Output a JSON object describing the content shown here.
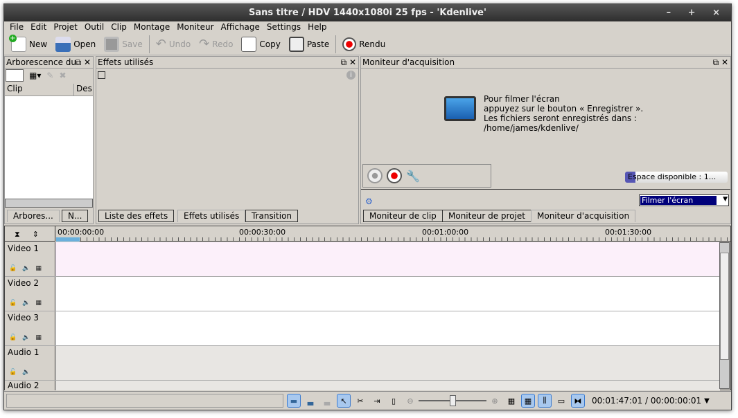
{
  "window": {
    "title": "Sans titre / HDV 1440x1080i 25 fps - 'Kdenlive'",
    "controls": "– + ×"
  },
  "menu": [
    "File",
    "Edit",
    "Projet",
    "Outil",
    "Clip",
    "Montage",
    "Moniteur",
    "Affichage",
    "Settings",
    "Help"
  ],
  "toolbar": {
    "new": "New",
    "open": "Open",
    "save": "Save",
    "undo": "Undo",
    "redo": "Redo",
    "copy": "Copy",
    "paste": "Paste",
    "render": "Rendu"
  },
  "project_tree": {
    "title": "Arborescence du",
    "col_clip": "Clip",
    "col_desc": "Des",
    "tab1": "Arbores...",
    "tab2": "N..."
  },
  "effects": {
    "title": "Effets utilisés",
    "tabs": [
      "Liste des effets",
      "Effets utilisés",
      "Transition"
    ]
  },
  "capture": {
    "title": "Moniteur d'acquisition",
    "msg1": "Pour filmer l'écran",
    "msg2": "appuyez sur le bouton « Enregistrer ».",
    "msg3": "Les fichiers seront enregistrés dans :",
    "msg4": "/home/james/kdenlive/",
    "space": "Espace disponible : 1...",
    "space_fraction": 0.1,
    "mode": "Filmer l'écran",
    "tabs": [
      "Moniteur de clip",
      "Moniteur de projet",
      "Moniteur d'acquisition"
    ]
  },
  "timeline": {
    "ruler": [
      "00:00:00:00",
      "00:00:30:00",
      "00:01:00:00",
      "00:01:30:00"
    ],
    "tracks": [
      "Video 1",
      "Video 2",
      "Video 3",
      "Audio 1",
      "Audio 2"
    ]
  },
  "status": {
    "timecode": "00:01:47:01 / 00:00:00:01",
    "zoom": 0.5
  }
}
